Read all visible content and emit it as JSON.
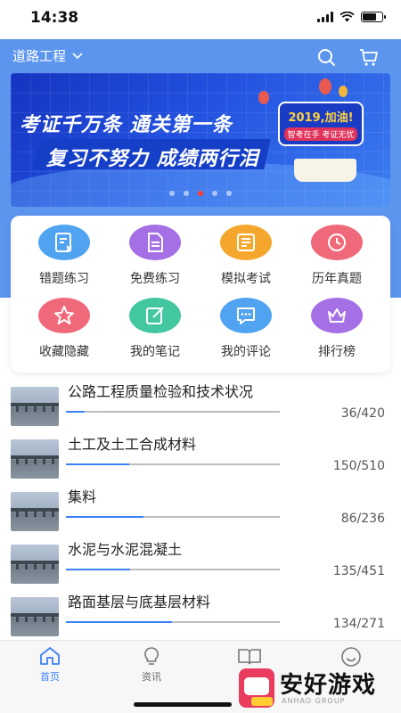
{
  "status_bar": {
    "time": "14:38"
  },
  "header": {
    "region": "道路工程",
    "icons": [
      "chevron-down-icon",
      "search-icon",
      "cart-icon"
    ],
    "color": "#5b95ee"
  },
  "banner": {
    "line1": "考证千万条 通关第一条",
    "line2": "复习不努力 成绩两行泪",
    "badge_title": "2019,加油!",
    "badge_sub": "智考在手 考证无忧",
    "slide_count": 5,
    "active_slide": 2
  },
  "categories": [
    {
      "label": "错题练习",
      "icon": "wrong-questions-icon",
      "color": "#4fa3f0"
    },
    {
      "label": "免费练习",
      "icon": "document-icon",
      "color": "#a56fe6"
    },
    {
      "label": "模拟考试",
      "icon": "exam-list-icon",
      "color": "#f4a72c"
    },
    {
      "label": "历年真题",
      "icon": "history-clock-icon",
      "color": "#f0697a"
    },
    {
      "label": "收藏隐藏",
      "icon": "star-icon",
      "color": "#f0697a"
    },
    {
      "label": "我的笔记",
      "icon": "notes-icon",
      "color": "#43c7a0"
    },
    {
      "label": "我的评论",
      "icon": "comment-icon",
      "color": "#4fa3f0"
    },
    {
      "label": "排行榜",
      "icon": "crown-icon",
      "color": "#a56fe6"
    }
  ],
  "chapters": [
    {
      "title": "公路工程质量检验和技术状况",
      "count": "36/420",
      "progress": 0.086
    },
    {
      "title": "土工及土工合成材料",
      "count": "150/510",
      "progress": 0.294
    },
    {
      "title": "集料",
      "count": "86/236",
      "progress": 0.364
    },
    {
      "title": "水泥与水泥混凝土",
      "count": "135/451",
      "progress": 0.299
    },
    {
      "title": "路面基层与底基层材料",
      "count": "134/271",
      "progress": 0.494
    }
  ],
  "tabs": [
    {
      "label": "首页",
      "icon": "home-icon",
      "active": true
    },
    {
      "label": "资讯",
      "icon": "lightbulb-icon",
      "active": false
    },
    {
      "label": "",
      "icon": "book-icon",
      "active": false
    },
    {
      "label": "",
      "icon": "smiley-icon",
      "active": false
    }
  ],
  "watermark": {
    "text": "安好游戏",
    "sub": "ANHAO GROUP"
  }
}
